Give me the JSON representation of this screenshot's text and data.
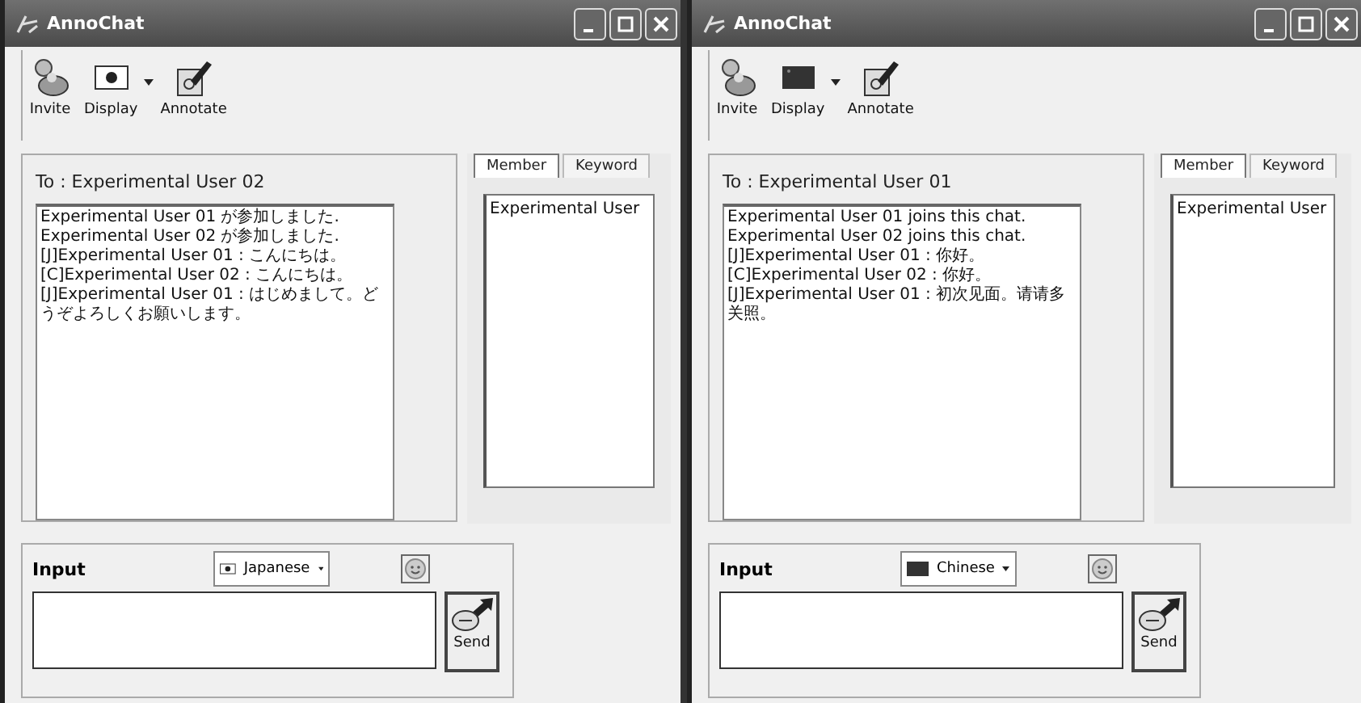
{
  "windows": [
    {
      "title": "AnnoChat",
      "toolbar": [
        {
          "kind": "invite",
          "label": "Invite"
        },
        {
          "kind": "display",
          "label": "Display",
          "flag": {
            "kind": "japan"
          }
        },
        {
          "kind": "annotate",
          "label": "Annotate"
        }
      ],
      "recipient": "To : Experimental User 02",
      "messages": [
        "Experimental User 01 が参加しました.",
        "Experimental User 02 が参加しました.",
        "[J]Experimental User 01 : こんにちは。",
        "[C]Experimental User 02 : こんにちは。",
        "[J]Experimental User 01 : はじめまして。どうぞよろしくお願いします。"
      ],
      "side_tabs": [
        {
          "label": "Member",
          "selected": true
        },
        {
          "label": "Keyword",
          "selected": false
        }
      ],
      "members": [
        "Experimental User"
      ],
      "input": {
        "label": "Input",
        "language": {
          "kind": "japan",
          "label": "Japanese"
        },
        "send": "Send"
      }
    },
    {
      "title": "AnnoChat",
      "toolbar": [
        {
          "kind": "invite",
          "label": "Invite"
        },
        {
          "kind": "display",
          "label": "Display",
          "flag": {
            "kind": "china"
          }
        },
        {
          "kind": "annotate",
          "label": "Annotate"
        }
      ],
      "recipient": "To : Experimental User 01",
      "messages": [
        "Experimental User 01 joins this chat.",
        "Experimental User 02 joins this chat.",
        "[J]Experimental User 01 : 你好。",
        "[C]Experimental User 02 : 你好。",
        "[J]Experimental User 01 : 初次见面。请请多关照。"
      ],
      "side_tabs": [
        {
          "label": "Member",
          "selected": true
        },
        {
          "label": "Keyword",
          "selected": false
        }
      ],
      "members": [
        "Experimental User"
      ],
      "input": {
        "label": "Input",
        "language": {
          "kind": "china",
          "label": "Chinese"
        },
        "send": "Send"
      }
    }
  ]
}
